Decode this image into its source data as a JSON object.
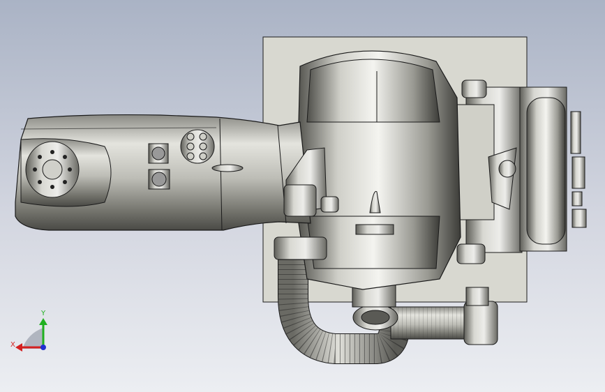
{
  "viewport": {
    "background_top": "#aab3c5",
    "background_bottom": "#eceef2",
    "model": {
      "body_color": "#c9c9c2",
      "body_dark": "#6e6e68",
      "base_plate_color": "#d8d8d0",
      "edge_color": "#1a1a1a"
    }
  },
  "triad": {
    "x_label": "X",
    "y_label": "Y",
    "x_color": "#d42020",
    "y_color": "#20b020",
    "z_color": "#2030d0"
  }
}
